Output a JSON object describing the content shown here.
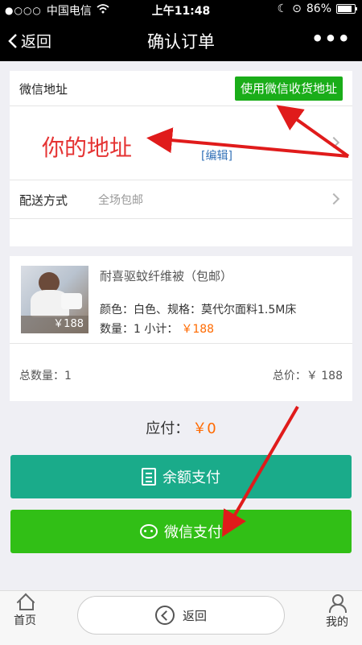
{
  "status_bar": {
    "carrier": "中国电信",
    "time": "上午11:48",
    "battery": "86%",
    "battery_level": 0.86
  },
  "nav": {
    "back_label": "返回",
    "title": "确认订单",
    "more_label": "•••"
  },
  "address": {
    "wechat_label": "微信地址",
    "use_wechat_button": "使用微信收货地址",
    "address_text": "你的地址",
    "edit_link": "[编辑]",
    "shipping_label": "配送方式",
    "shipping_value": "全场包邮"
  },
  "product": {
    "name": "耐喜驱蚊纤维被（包邮）",
    "image_price": "￥188",
    "spec": "颜色：白色、规格：莫代尔面料1.5M床",
    "qty_label": "数量：1  小计：",
    "subtotal": "￥188",
    "total_qty": "总数量：1",
    "total_price": "总价：￥ 188"
  },
  "payment": {
    "due_label": "应付：",
    "due_amount": "￥0",
    "balance_button": "余额支付",
    "wechat_button": "微信支付"
  },
  "bottom_bar": {
    "home": "首页",
    "back": "返回",
    "mine": "我的"
  },
  "colors": {
    "wechat_green": "#1aad19",
    "balance_teal": "#1aab8a",
    "accent_orange": "#ff6a00",
    "annotation_red": "#e01b1b"
  }
}
